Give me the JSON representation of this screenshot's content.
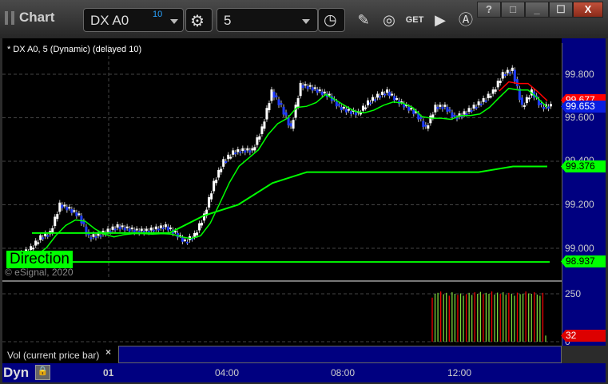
{
  "window": {
    "title": "Chart",
    "buttons": [
      "?",
      "□",
      "_",
      "☐",
      "X"
    ]
  },
  "toolbar": {
    "symbol": "DX A0",
    "symbol_badge": "10",
    "interval": "5"
  },
  "chart": {
    "symbol_label": "* DX A0, 5 (Dynamic) (delayed 10)",
    "direction_label": "Direction",
    "copyright": "© eSignal, 2020",
    "price_ticks": [
      "99.800",
      "99.600",
      "99.400",
      "99.200",
      "99.000"
    ],
    "tags": {
      "red": "99.677",
      "last": "99.653",
      "upper_green": "99.376",
      "lower_green": "98.937"
    },
    "volume_ticks": [
      "250",
      "0"
    ],
    "volume_last": "32",
    "volume_label": "Vol (current price bar)",
    "close_label": "×",
    "time_labels": [
      "01",
      "04:00",
      "08:00",
      "12:00"
    ],
    "mode": "Dyn"
  },
  "chart_data": {
    "type": "candlestick",
    "ylim": [
      98.86,
      99.86
    ],
    "closes": [
      98.94,
      98.97,
      99.0,
      99.05,
      99.07,
      99.2,
      99.18,
      99.15,
      99.05,
      99.06,
      99.08,
      99.1,
      99.09,
      99.08,
      99.08,
      99.09,
      99.1,
      99.07,
      99.03,
      99.06,
      99.15,
      99.3,
      99.4,
      99.44,
      99.45,
      99.45,
      99.55,
      99.72,
      99.65,
      99.55,
      99.75,
      99.74,
      99.72,
      99.7,
      99.65,
      99.63,
      99.62,
      99.67,
      99.7,
      99.72,
      99.68,
      99.65,
      99.62,
      99.55,
      99.65,
      99.65,
      99.6,
      99.62,
      99.65,
      99.68,
      99.72,
      99.8,
      99.82,
      99.65,
      99.72,
      99.65,
      99.653
    ],
    "step_line": [
      99.07,
      99.07,
      99.07,
      99.07,
      99.07,
      99.15,
      99.2,
      99.3,
      99.35,
      99.35,
      99.35,
      99.35,
      99.35,
      99.35,
      99.376,
      99.376
    ],
    "lower_line": 98.937,
    "volume": [
      230,
      250,
      255,
      262,
      248,
      255,
      240,
      258,
      250,
      245,
      252,
      240,
      248,
      255,
      244,
      258,
      250,
      260,
      248,
      255,
      250,
      262,
      246,
      256,
      250,
      258,
      245,
      255,
      250,
      240,
      256,
      248,
      250,
      262,
      252,
      250,
      258,
      246,
      240,
      255,
      32
    ]
  },
  "colors": {
    "bull": "#ffffff",
    "bear": "#1f3cff",
    "ma_green": "#00ff00",
    "ma_red": "#ff0000",
    "axis_bg": "#000080"
  }
}
